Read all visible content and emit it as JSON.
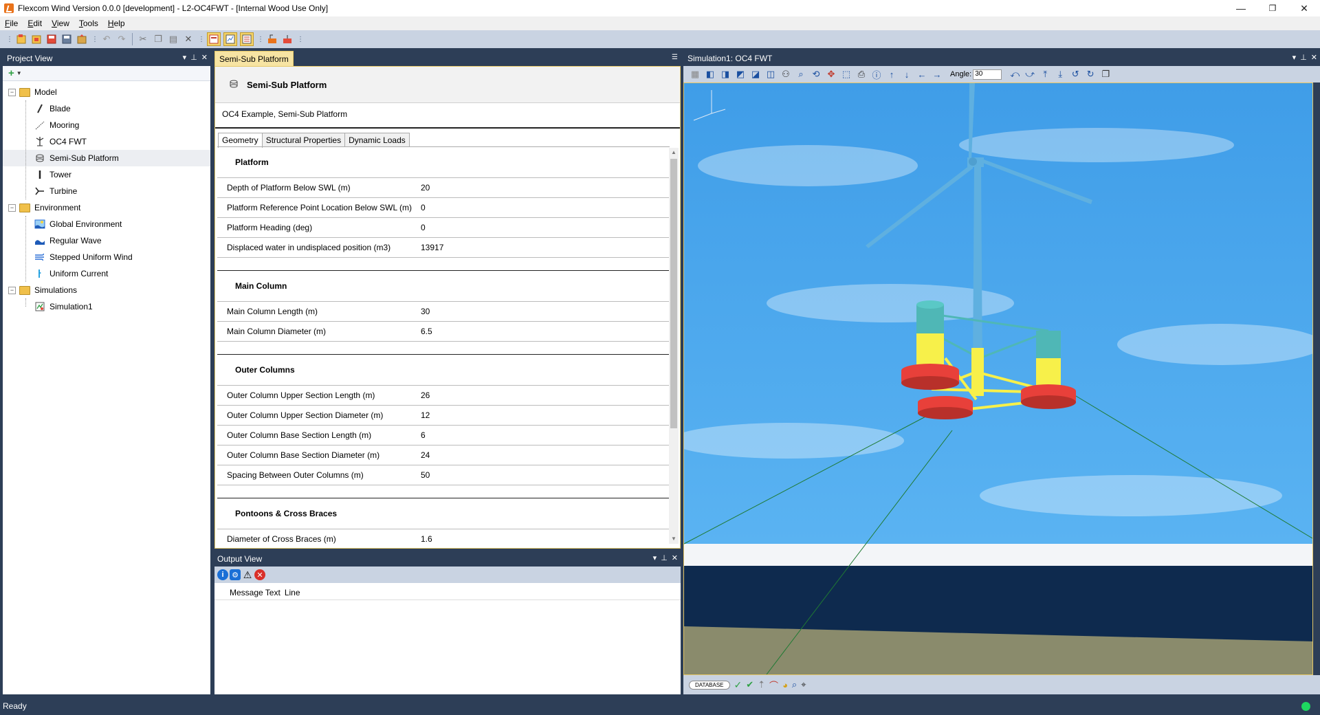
{
  "window": {
    "title": "Flexcom Wind Version 0.0.0 [development] - L2-OC4FWT - [Internal Wood Use Only]",
    "minimize": "—",
    "maximize": "❐",
    "close": "✕"
  },
  "menu": [
    "File",
    "Edit",
    "View",
    "Tools",
    "Help"
  ],
  "project_view": {
    "title": "Project View",
    "add_label": "+",
    "tree": {
      "model": {
        "label": "Model",
        "children": [
          "Blade",
          "Mooring",
          "OC4 FWT",
          "Semi-Sub Platform",
          "Tower",
          "Turbine"
        ]
      },
      "environment": {
        "label": "Environment",
        "children": [
          "Global Environment",
          "Regular Wave",
          "Stepped Uniform Wind",
          "Uniform Current"
        ]
      },
      "simulations": {
        "label": "Simulations",
        "children": [
          "Simulation1"
        ]
      }
    },
    "selected": "Semi-Sub Platform"
  },
  "editor": {
    "doc_tab": "Semi-Sub Platform",
    "title": "Semi-Sub Platform",
    "description": "OC4 Example, Semi-Sub Platform",
    "tabs": [
      "Geometry",
      "Structural Properties",
      "Dynamic Loads"
    ],
    "active_tab": "Geometry",
    "sections": {
      "platform": {
        "heading": "Platform",
        "rows": [
          {
            "label": "Depth of Platform Below SWL (m)",
            "value": "20"
          },
          {
            "label": "Platform Reference Point Location Below SWL (m)",
            "value": "0"
          },
          {
            "label": "Platform Heading (deg)",
            "value": "0"
          },
          {
            "label": "Displaced water in undisplaced position (m3)",
            "value": "13917"
          }
        ]
      },
      "main_column": {
        "heading": "Main Column",
        "rows": [
          {
            "label": "Main Column Length (m)",
            "value": "30"
          },
          {
            "label": "Main Column Diameter (m)",
            "value": "6.5"
          }
        ]
      },
      "outer_columns": {
        "heading": "Outer Columns",
        "rows": [
          {
            "label": "Outer Column Upper Section Length (m)",
            "value": "26"
          },
          {
            "label": "Outer Column Upper Section Diameter (m)",
            "value": "12"
          },
          {
            "label": "Outer Column Base Section Length (m)",
            "value": "6"
          },
          {
            "label": "Outer Column Base Section Diameter (m)",
            "value": "24"
          },
          {
            "label": "Spacing Between Outer Columns (m)",
            "value": "50"
          }
        ]
      },
      "pontoons": {
        "heading": "Pontoons & Cross Braces",
        "rows": [
          {
            "label": "Diameter of Cross Braces (m)",
            "value": "1.6"
          }
        ]
      }
    }
  },
  "output_view": {
    "title": "Output View",
    "columns": [
      "Message Text",
      "Line"
    ]
  },
  "simulation_view": {
    "title": "Simulation1: OC4 FWT",
    "angle_label": "Angle:",
    "angle_value": "30",
    "database_label": "DATABASE",
    "colors": {
      "sky": "#4aa6ee",
      "sea": "#0e2a4e",
      "seabed": "#8a8b6c",
      "turbine": "#5fb0e0",
      "column_top": "#4fb7b6",
      "column_mid": "#f7f04a",
      "base": "#e8403a"
    }
  },
  "status": {
    "text": "Ready"
  }
}
